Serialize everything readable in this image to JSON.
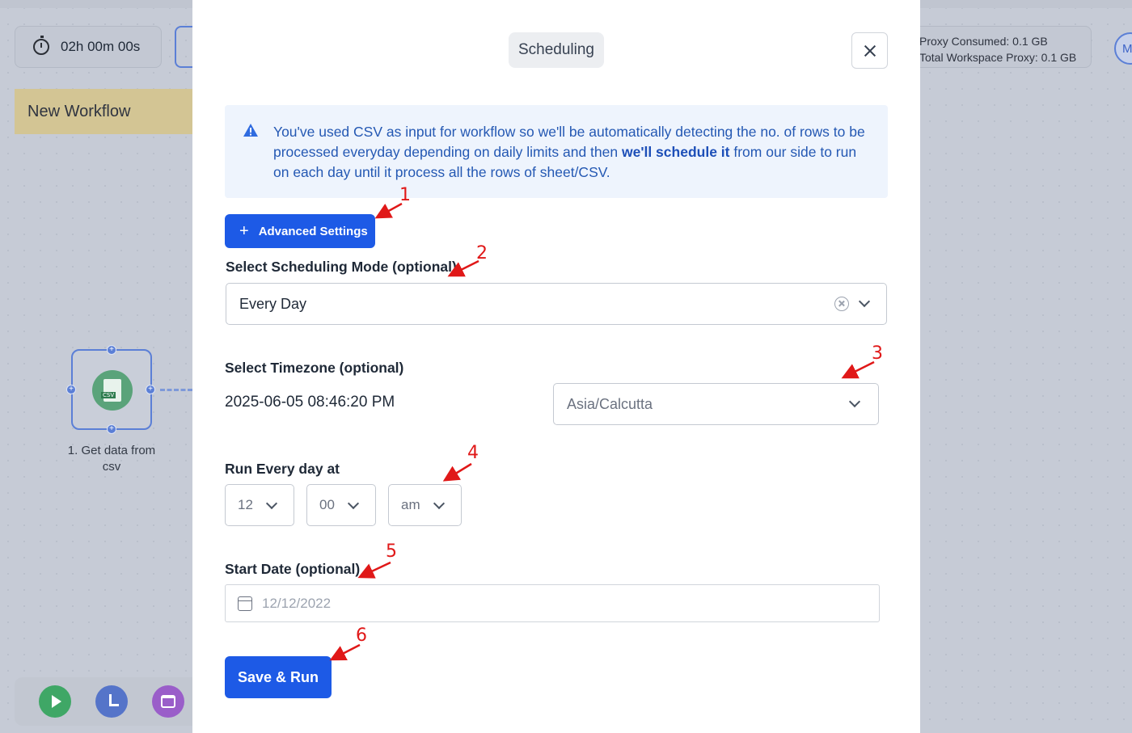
{
  "background": {
    "timer": "02h 00m 00s",
    "workflow_name": "New Workflow",
    "node_label": "1. Get data from csv",
    "node_badge": "CSV",
    "proxy": {
      "consumed": "Proxy Consumed: 0.1 GB",
      "total": "Total Workspace Proxy: 0.1 GB"
    },
    "avatar": "MA",
    "icons": [
      "timer-icon",
      "csv-file-icon",
      "play-icon",
      "clock-icon",
      "calendar-icon"
    ]
  },
  "modal": {
    "title": "Scheduling",
    "info": {
      "part1": "You've used CSV as input for workflow so we'll be automatically detecting the no. of rows to be processed everyday depending on daily limits and then ",
      "bold": "we'll schedule it",
      "part2": " from our side to run on each day until it process all the rows of sheet/CSV."
    },
    "advanced_button": "Advanced Settings",
    "mode_label": "Select Scheduling Mode (optional)",
    "mode_value": "Every Day",
    "timezone_label": "Select Timezone (optional)",
    "current_datetime": "2025-06-05 08:46:20 PM",
    "timezone_value": "Asia/Calcutta",
    "run_label": "Run Every day at",
    "hour": "12",
    "minute": "00",
    "ampm": "am",
    "start_date_label": "Start Date (optional)",
    "start_date_placeholder": "12/12/2022",
    "save_button": "Save & Run"
  },
  "annotations": [
    "1",
    "2",
    "3",
    "4",
    "5",
    "6"
  ],
  "colors": {
    "primary": "#1d5ae6",
    "info_bg": "#eef4fd",
    "info_text": "#2458b3",
    "annotation": "#e01818"
  }
}
